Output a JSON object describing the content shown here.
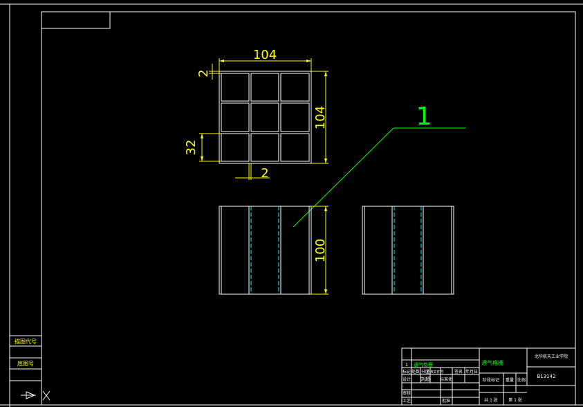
{
  "colors": {
    "background": "#000000",
    "frame": "#ffffff",
    "dimension": "#ffff00",
    "leader": "#00ff00",
    "hidden_line": "#00ffff",
    "table_text": "#ffffff"
  },
  "dimensions": {
    "top_width": "104",
    "wall_top": "2",
    "right_height": "104",
    "cell": "32",
    "wall_bottom": "2",
    "front_height": "100"
  },
  "balloon": {
    "label": "1"
  },
  "side_labels": {
    "upper": "描图代号",
    "lower": "底图号"
  },
  "title_block": {
    "part_no": "1",
    "part_name": "通气格栅",
    "drawing_name": "通气格栅",
    "company": "北华航天工业学院",
    "drawing_code": "B13142",
    "row_headers": [
      "标记",
      "处数",
      "分区",
      "更改文件号",
      "签名",
      "年月日"
    ],
    "designer_label": "设计",
    "designer_name": "刘超",
    "standard_label": "标准化",
    "stage_label": "阶段标记",
    "weight_label": "重量",
    "scale_label": "比例",
    "review_label": "审核",
    "process_label": "工艺",
    "approve_label": "批准",
    "sheets": "共 1 张",
    "sheet_no": "第 1 张"
  }
}
